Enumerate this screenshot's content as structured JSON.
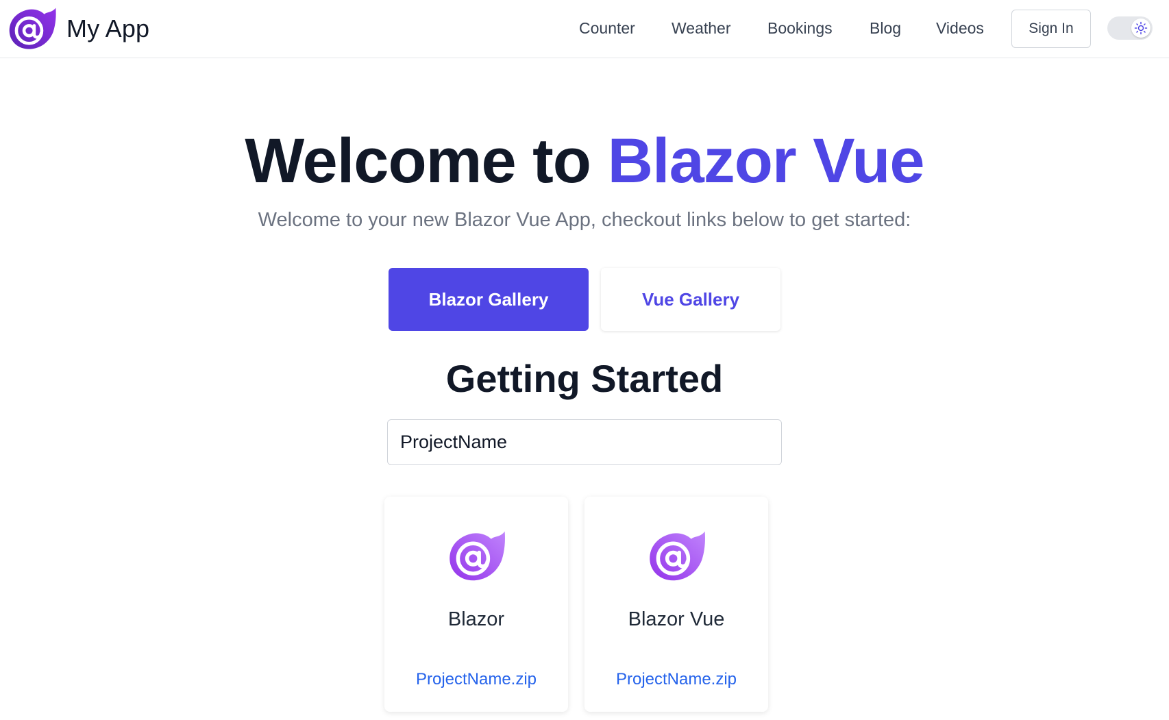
{
  "header": {
    "app_name": "My App",
    "nav": [
      "Counter",
      "Weather",
      "Bookings",
      "Blog",
      "Videos"
    ],
    "sign_in": "Sign In"
  },
  "hero": {
    "title_prefix": "Welcome to ",
    "title_accent": "Blazor Vue",
    "subtitle": "Welcome to your new Blazor Vue App, checkout links below to get started:",
    "primary_button": "Blazor Gallery",
    "secondary_button": "Vue Gallery"
  },
  "getting_started": {
    "title": "Getting Started",
    "project_input_value": "ProjectName",
    "cards": [
      {
        "title": "Blazor",
        "link": "ProjectName.zip"
      },
      {
        "title": "Blazor Vue",
        "link": "ProjectName.zip"
      }
    ]
  },
  "colors": {
    "accent": "#4f46e5",
    "logo_purple": "#7c3aed",
    "link_blue": "#2563eb"
  },
  "icons": {
    "brand": "blazor-logo-icon",
    "theme_toggle": "sun-icon",
    "card": "blazor-logo-icon"
  }
}
